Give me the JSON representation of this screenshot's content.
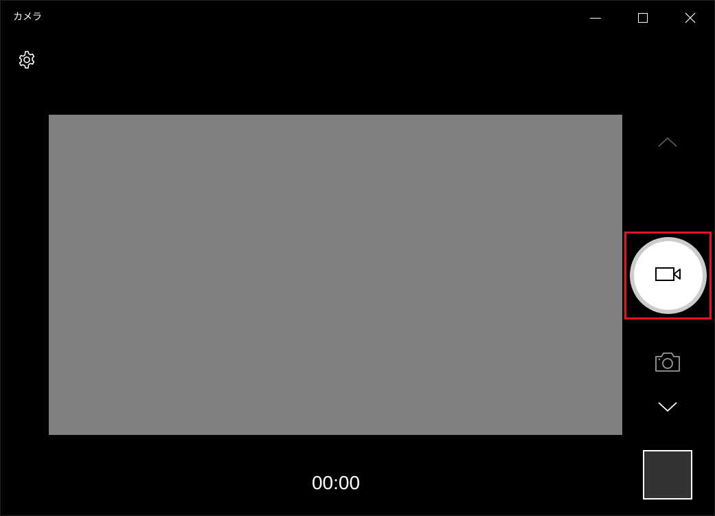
{
  "window": {
    "title": "カメラ",
    "controls": {
      "minimize_icon": "minimize-icon",
      "maximize_icon": "maximize-icon",
      "close_icon": "close-icon"
    }
  },
  "settings": {
    "icon": "gear-icon"
  },
  "preview": {
    "color": "#808080"
  },
  "recording": {
    "timer": "00:00"
  },
  "mode_switcher": {
    "up_icon": "chevron-up-icon",
    "down_icon": "chevron-down-icon",
    "capture_icon": "video-camera-icon",
    "alternate_mode_icon": "camera-icon"
  },
  "colors": {
    "background": "#000000",
    "highlight": "#e81123",
    "capture_button": "#ffffff",
    "capture_ring": "#cccccc",
    "thumbnail": "#333333"
  }
}
